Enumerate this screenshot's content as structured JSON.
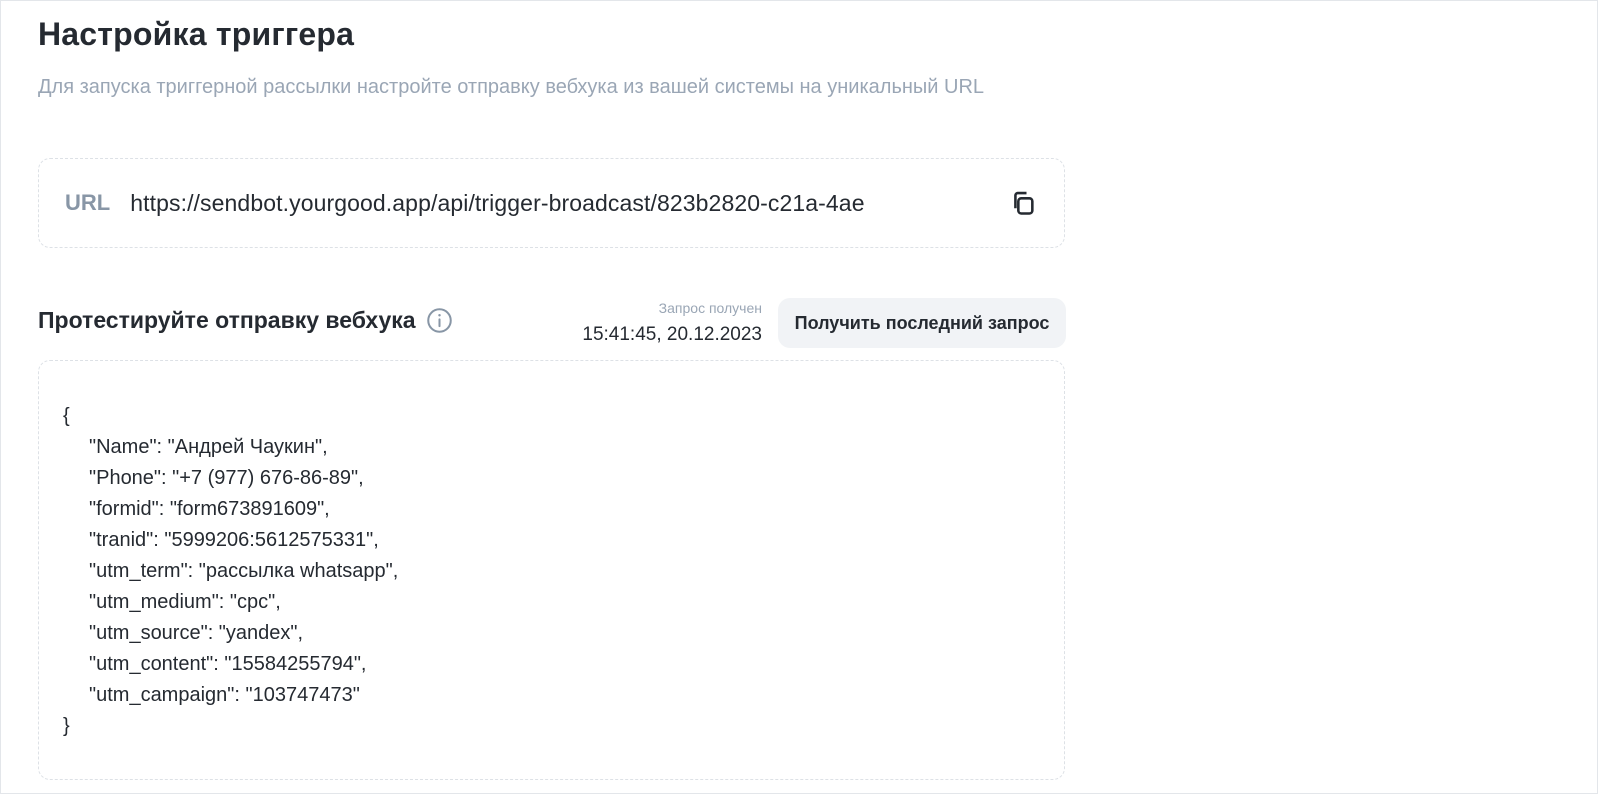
{
  "header": {
    "title": "Настройка триггера",
    "subtitle": "Для запуска триггерной рассылки настройте отправку вебхука из вашей системы на уникальный URL"
  },
  "url_field": {
    "label": "URL",
    "value": "https://sendbot.yourgood.app/api/trigger-broadcast/823b2820-c21a-4ae",
    "copy_icon": "copy-icon"
  },
  "test_section": {
    "title": "Протестируйте отправку вебхука",
    "info_icon": "info-icon",
    "request_received_label": "Запрос получен",
    "request_received_time": "15:41:45, 20.12.2023",
    "fetch_button_label": "Получить последний запрос"
  },
  "payload": {
    "open_brace": "{",
    "lines": [
      "\"Name\": \"Андрей Чаукин\",",
      "\"Phone\": \"+7 (977) 676-86-89\",",
      "\"formid\": \"form673891609\",",
      "\"tranid\": \"5999206:5612575331\",",
      "\"utm_term\": \"рассылка whatsapp\",",
      "\"utm_medium\": \"cpc\",",
      "\"utm_source\": \"yandex\",",
      "\"utm_content\": \"15584255794\",",
      "\"utm_campaign\": \"103747473\""
    ],
    "close_brace": "}"
  },
  "colors": {
    "text_primary": "#252a31",
    "text_muted": "#9aa6b5",
    "border_dashed": "#dde1e6",
    "button_bg": "#f1f3f6"
  }
}
